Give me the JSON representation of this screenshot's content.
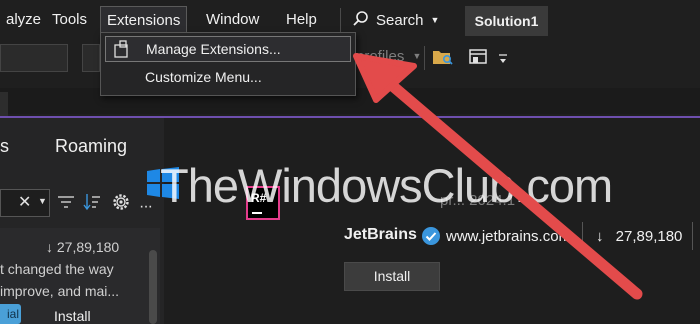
{
  "menubar": {
    "items": [
      "alyze",
      "Tools",
      "Extensions",
      "Window",
      "Help"
    ],
    "search_label": "Search",
    "solution_name": "Solution1"
  },
  "toolbar": {
    "profiles_text": "profiles"
  },
  "dropdown": {
    "items": [
      "Manage Extensions...",
      "Customize Menu..."
    ]
  },
  "left_panel": {
    "tab_partial": "s",
    "tab_roaming": "Roaming",
    "download_count": "27,89,180",
    "desc_line1": "t changed the way",
    "desc_line2": "improve, and mai...",
    "trial_label": "ial",
    "install_label": "Install"
  },
  "detail": {
    "title_partial": "pr... 2024.1",
    "publisher": "JetBrains",
    "url": "www.jetbrains.com",
    "download_count": "27,89,180",
    "install_label": "Install",
    "logo_text": "R#"
  },
  "watermark": {
    "text": "TheWindowsClub.com"
  },
  "colors": {
    "accent_purple": "#6e4fae",
    "arrow_red": "#e34b4b",
    "verified_blue": "#3a96dd"
  }
}
